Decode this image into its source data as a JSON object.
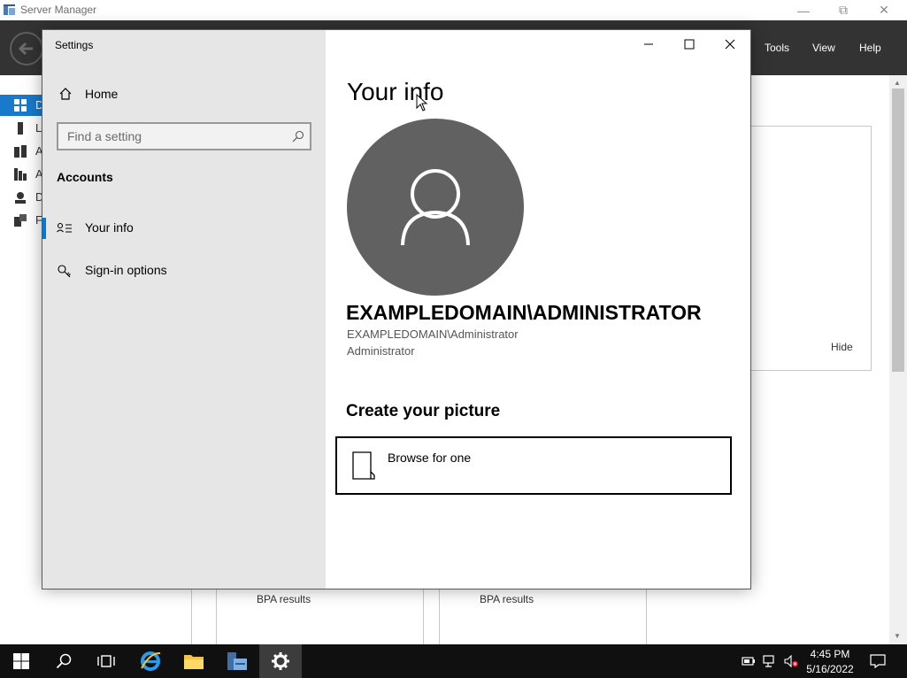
{
  "background_app": {
    "title": "Server Manager",
    "menu": [
      "Tools",
      "View",
      "Help"
    ],
    "nav_letters": [
      "D",
      "L",
      "A",
      "A",
      "D",
      "F"
    ],
    "tile_link": "Hide",
    "bpa_labels": [
      "BPA results",
      "BPA results"
    ]
  },
  "settings": {
    "window_title": "Settings",
    "home_label": "Home",
    "search_placeholder": "Find a setting",
    "section_heading": "Accounts",
    "nav_items": [
      {
        "label": "Your info",
        "icon": "person-list-icon",
        "selected": true
      },
      {
        "label": "Sign-in options",
        "icon": "key-icon",
        "selected": false
      }
    ],
    "page_title": "Your info",
    "account_display_name": "EXAMPLEDOMAIN\\ADMINISTRATOR",
    "account_id": "EXAMPLEDOMAIN\\Administrator",
    "account_type": "Administrator",
    "create_heading": "Create your picture",
    "browse_label": "Browse for one"
  },
  "taskbar": {
    "time": "4:45 PM",
    "date": "5/16/2022",
    "pinned": [
      "start-icon",
      "search-icon",
      "task-view-icon",
      "internet-explorer-icon",
      "file-explorer-icon",
      "server-manager-icon",
      "settings-gear-icon"
    ]
  },
  "colors": {
    "accent": "#0078d7",
    "toolbar": "#333333",
    "sidebar": "#e6e6e6",
    "avatar": "#616161",
    "taskbar": "#101010"
  }
}
